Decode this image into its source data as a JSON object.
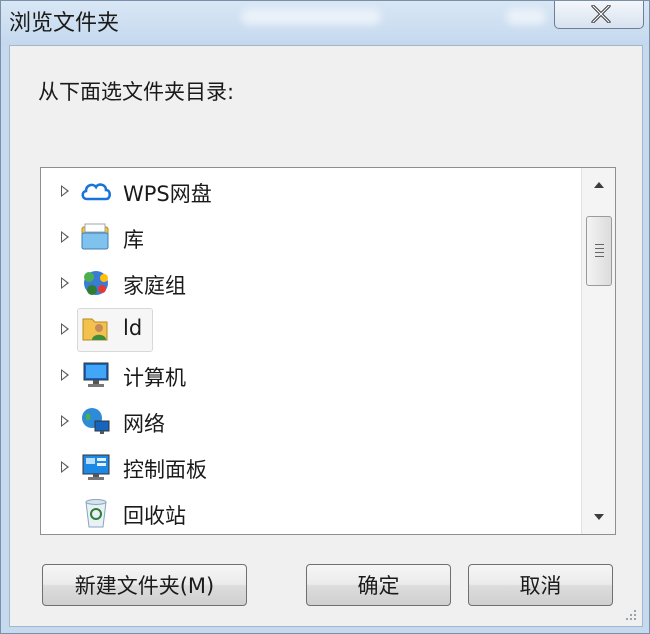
{
  "window": {
    "title": "浏览文件夹",
    "close_icon": "close-icon"
  },
  "dialog": {
    "prompt": "从下面选文件夹目录:"
  },
  "tree": {
    "items": [
      {
        "label": "WPS网盘",
        "icon": "cloud-icon",
        "expandable": true,
        "selected": false
      },
      {
        "label": "库",
        "icon": "library-icon",
        "expandable": true,
        "selected": false
      },
      {
        "label": "家庭组",
        "icon": "homegroup-icon",
        "expandable": true,
        "selected": false
      },
      {
        "label": "ld",
        "icon": "user-folder-icon",
        "expandable": true,
        "selected": true
      },
      {
        "label": "计算机",
        "icon": "computer-icon",
        "expandable": true,
        "selected": false
      },
      {
        "label": "网络",
        "icon": "network-icon",
        "expandable": true,
        "selected": false
      },
      {
        "label": "控制面板",
        "icon": "control-panel-icon",
        "expandable": true,
        "selected": false
      },
      {
        "label": "回收站",
        "icon": "recycle-bin-icon",
        "expandable": false,
        "selected": false
      }
    ]
  },
  "buttons": {
    "new_folder": "新建文件夹(M)",
    "ok": "确定",
    "cancel": "取消"
  },
  "colors": {
    "frame": "#c6daef",
    "client_bg": "#f0f0f0",
    "tree_bg": "#ffffff"
  }
}
